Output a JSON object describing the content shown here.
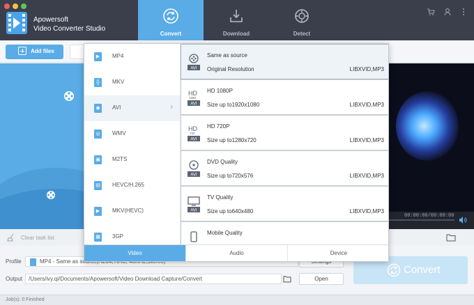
{
  "app": {
    "brand_line1": "Apowersoft",
    "brand_line2": "Video Converter Studio"
  },
  "nav": {
    "tabs": [
      {
        "label": "Convert",
        "icon": "convert-icon",
        "active": true
      },
      {
        "label": "Download",
        "icon": "download-icon",
        "active": false
      },
      {
        "label": "Detect",
        "icon": "detect-icon",
        "active": false
      }
    ]
  },
  "header_icons": [
    "cart-icon",
    "user-icon",
    "menu-icon"
  ],
  "toolbar": {
    "add_files_label": "Add files"
  },
  "task": {
    "clear_label": "Clear task list"
  },
  "player": {
    "timecode": "00:00:00/00:00:00"
  },
  "bottom": {
    "profile_label": "Profile",
    "profile_value": "MP4 - Same as source(H264, AAC, 48KHz,Stereo)",
    "settings_label": "Settings",
    "output_label": "Output",
    "output_value": "/Users/ivy.qi/Documents/Apowersoft/Video Download Capture/Convert",
    "open_label": "Open",
    "convert_label": "Convert",
    "jobs_status": "Job(s): 0 Finished"
  },
  "dropdown": {
    "formats": [
      {
        "label": "MP4",
        "selected": false
      },
      {
        "label": "MKV",
        "selected": false
      },
      {
        "label": "AVI",
        "selected": true
      },
      {
        "label": "WMV",
        "selected": false
      },
      {
        "label": "M2TS",
        "selected": false
      },
      {
        "label": "HEVC/H.265",
        "selected": false
      },
      {
        "label": "MKV(HEVC)",
        "selected": false
      },
      {
        "label": "3GP",
        "selected": false
      }
    ],
    "presets": [
      {
        "name": "Same as source",
        "desc": "Original Resolution",
        "codec": "LIBXVID,MP3",
        "icon_tag": "AVI",
        "icon": "film-reel-icon",
        "selected": true
      },
      {
        "name": "HD 1080P",
        "desc": "Size up to1920x1080",
        "codec": "LIBXVID,MP3",
        "icon_tag": "AVI",
        "icon": "hd-1080-icon",
        "selected": false
      },
      {
        "name": "HD 720P",
        "desc": "Size up to1280x720",
        "codec": "LIBXVID,MP3",
        "icon_tag": "AVI",
        "icon": "hd-720-icon",
        "selected": false
      },
      {
        "name": "DVD Quality",
        "desc": "Size up to720x576",
        "codec": "LIBXVID,MP3",
        "icon_tag": "AVI",
        "icon": "dvd-icon",
        "selected": false
      },
      {
        "name": "TV Quality",
        "desc": "Size up to640x480",
        "codec": "LIBXVID,MP3",
        "icon_tag": "AVI",
        "icon": "tv-icon",
        "selected": false
      },
      {
        "name": "Mobile Quality",
        "desc": "",
        "codec": "",
        "icon_tag": "",
        "icon": "mobile-icon",
        "selected": false
      }
    ],
    "categories": [
      {
        "label": "Video",
        "active": true
      },
      {
        "label": "Audio",
        "active": false
      },
      {
        "label": "Device",
        "active": false
      }
    ]
  },
  "colors": {
    "accent": "#5aace6",
    "header_bg": "#3b3f4c"
  }
}
